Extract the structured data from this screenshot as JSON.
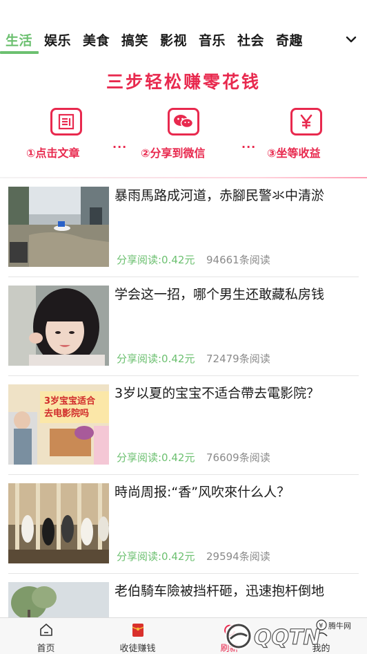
{
  "tabs": {
    "items": [
      "生活",
      "娱乐",
      "美食",
      "搞笑",
      "影视",
      "音乐",
      "社会",
      "奇趣"
    ],
    "active_index": 0
  },
  "banner": {
    "title": "三步轻松赚零花钱",
    "steps": [
      "①点击文章",
      "②分享到微信",
      "③坐等收益"
    ],
    "dots": "···",
    "icons": [
      "document-icon",
      "wechat-icon",
      "yen-icon"
    ]
  },
  "articles": [
    {
      "title": "暴雨馬路成河道，赤腳民警氺中清淤",
      "share": "分享阅读:0.42元",
      "reads": "94661条阅读"
    },
    {
      "title": "学会这一招，哪个男生还敢藏私房钱",
      "share": "分享阅读:0.42元",
      "reads": "72479条阅读"
    },
    {
      "title": "3岁以夏的宝宝不适合帶去電影院？",
      "share": "分享阅读:0.42元",
      "reads": "76609条阅读",
      "thumb_text": [
        "3岁宝宝适合",
        "去电影院吗"
      ]
    },
    {
      "title": "時尚周报:“香”风吹來什么人？",
      "share": "分享阅读:0.42元",
      "reads": "29594条阅读"
    },
    {
      "title": "老伯騎车險被挡杆砸，迅速抱杆倒地"
    }
  ],
  "bottom_nav": {
    "items": [
      {
        "label": "首页",
        "icon": "home-icon"
      },
      {
        "label": "收徒赚钱",
        "icon": "red-envelope-icon"
      },
      {
        "label": "刷新",
        "icon": "refresh-icon"
      },
      {
        "label": "我的",
        "icon": "user-icon"
      }
    ]
  },
  "watermark": {
    "text": "QQTN",
    "sub": "腾牛网"
  },
  "colors": {
    "accent_green": "#6cc070",
    "banner_red": "#e8294e",
    "read_gray": "#8a8a8a"
  }
}
